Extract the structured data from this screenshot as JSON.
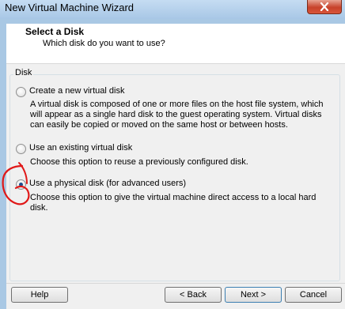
{
  "window": {
    "title": "New Virtual Machine Wizard"
  },
  "header": {
    "title": "Select a Disk",
    "subtitle": "Which disk do you want to use?"
  },
  "group": {
    "label": "Disk"
  },
  "options": [
    {
      "label": "Create a new virtual disk",
      "description": "A virtual disk is composed of one or more files on the host file system, which will appear as a single hard disk to the guest operating system. Virtual disks can easily be copied or moved on the same host or between hosts.",
      "selected": false
    },
    {
      "label": "Use an existing virtual disk",
      "description": "Choose this option to reuse a previously configured disk.",
      "selected": false
    },
    {
      "label": "Use a physical disk (for advanced users)",
      "description": "Choose this option to give the virtual machine direct access to a local hard disk.",
      "selected": true
    }
  ],
  "buttons": {
    "help": "Help",
    "back": "< Back",
    "next": "Next >",
    "cancel": "Cancel"
  },
  "colors": {
    "annotation": "#e01818",
    "titlebar": "#a9c8e4",
    "close_button": "#c7422b"
  },
  "icons": {
    "close": "close-icon"
  }
}
